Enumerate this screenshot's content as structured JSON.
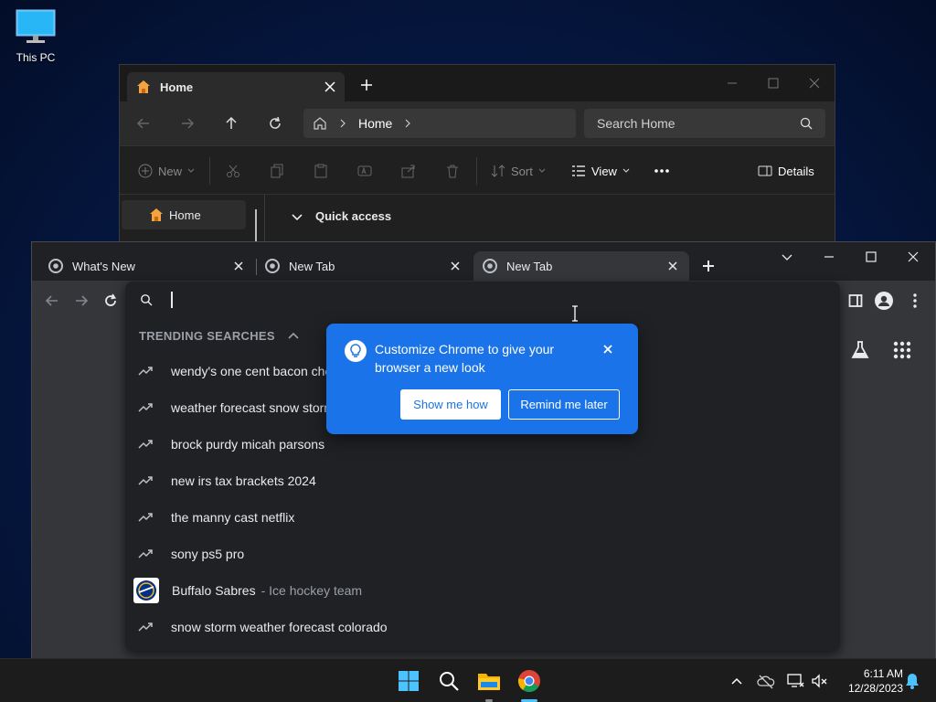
{
  "desktop": {
    "this_pc_label": "This PC"
  },
  "explorer": {
    "tab_label": "Home",
    "breadcrumb": "Home",
    "search_placeholder": "Search Home",
    "toolbar": {
      "new": "New",
      "sort": "Sort",
      "view": "View",
      "details": "Details"
    },
    "nav_home": "Home",
    "quick_access": "Quick access"
  },
  "chrome": {
    "tabs": [
      {
        "label": "What's New"
      },
      {
        "label": "New Tab"
      },
      {
        "label": "New Tab"
      }
    ],
    "omnibox": {
      "value": "",
      "section_title": "TRENDING SEARCHES",
      "suggestions": [
        {
          "text": "wendy's one cent bacon che"
        },
        {
          "text": "weather forecast snow storm"
        },
        {
          "text": "brock purdy micah parsons"
        },
        {
          "text": "new irs tax brackets 2024"
        },
        {
          "text": "the manny cast netflix"
        },
        {
          "text": "sony ps5 pro"
        },
        {
          "text": "Buffalo Sabres",
          "sub": "- Ice hockey team"
        },
        {
          "text": "snow storm weather forecast colorado"
        }
      ]
    },
    "promo": {
      "message": "Customize Chrome to give your browser a new look",
      "primary_button": "Show me how",
      "secondary_button": "Remind me later"
    }
  },
  "taskbar": {
    "time": "6:11 AM",
    "date": "12/28/2023"
  },
  "colors": {
    "promo_blue": "#1a73e8",
    "explorer_bg": "#202020",
    "chrome_dark": "#202124"
  }
}
